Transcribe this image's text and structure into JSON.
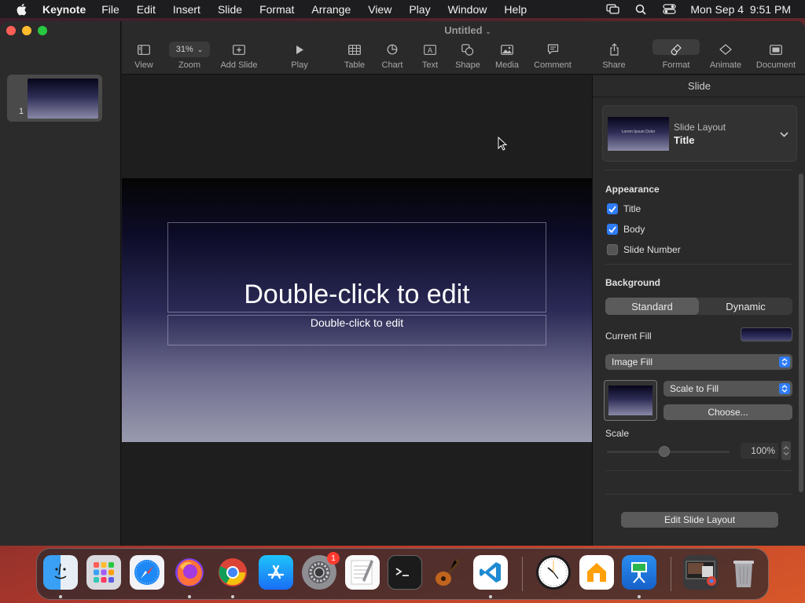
{
  "menubar": {
    "app": "Keynote",
    "items": [
      "File",
      "Edit",
      "Insert",
      "Slide",
      "Format",
      "Arrange",
      "View",
      "Play",
      "Window",
      "Help"
    ],
    "datetime": "Mon Sep 4  9:51 PM"
  },
  "window": {
    "title": "Untitled"
  },
  "toolbar": {
    "view": "View",
    "zoom_value": "31%",
    "zoom": "Zoom",
    "add_slide": "Add Slide",
    "play": "Play",
    "table": "Table",
    "chart": "Chart",
    "text": "Text",
    "shape": "Shape",
    "media": "Media",
    "comment": "Comment",
    "share": "Share",
    "format": "Format",
    "animate": "Animate",
    "document": "Document"
  },
  "navigator": {
    "slides": [
      {
        "number": "1"
      }
    ]
  },
  "slide": {
    "title_placeholder": "Double-click to edit",
    "body_placeholder": "Double-click to edit"
  },
  "inspector": {
    "title": "Slide",
    "layout_label": "Slide Layout",
    "layout_value": "Title",
    "layout_thumb_text": "Lorem Ipsum Dolor",
    "appearance_label": "Appearance",
    "appearance": [
      {
        "label": "Title",
        "checked": true
      },
      {
        "label": "Body",
        "checked": true
      },
      {
        "label": "Slide Number",
        "checked": false
      }
    ],
    "background_label": "Background",
    "background_tabs": [
      "Standard",
      "Dynamic"
    ],
    "background_active": "Standard",
    "current_fill_label": "Current Fill",
    "fill_type": "Image Fill",
    "scale_mode": "Scale to Fill",
    "choose_button": "Choose...",
    "scale_label": "Scale",
    "scale_value": "100%",
    "edit_layout_button": "Edit Slide Layout"
  },
  "dock": {
    "apps": [
      "Finder",
      "Launchpad",
      "Safari",
      "Firefox",
      "Chrome",
      "App Store",
      "System Settings",
      "TextEdit",
      "Terminal",
      "GarageBand",
      "Visual Studio Code",
      "Clock",
      "Home",
      "Keynote",
      "Downloads",
      "Trash"
    ],
    "settings_badge": "1"
  },
  "colors": {
    "accent": "#2f7cf6",
    "close": "#ff5f57",
    "minimize": "#febc2e",
    "maximize": "#28c840"
  }
}
